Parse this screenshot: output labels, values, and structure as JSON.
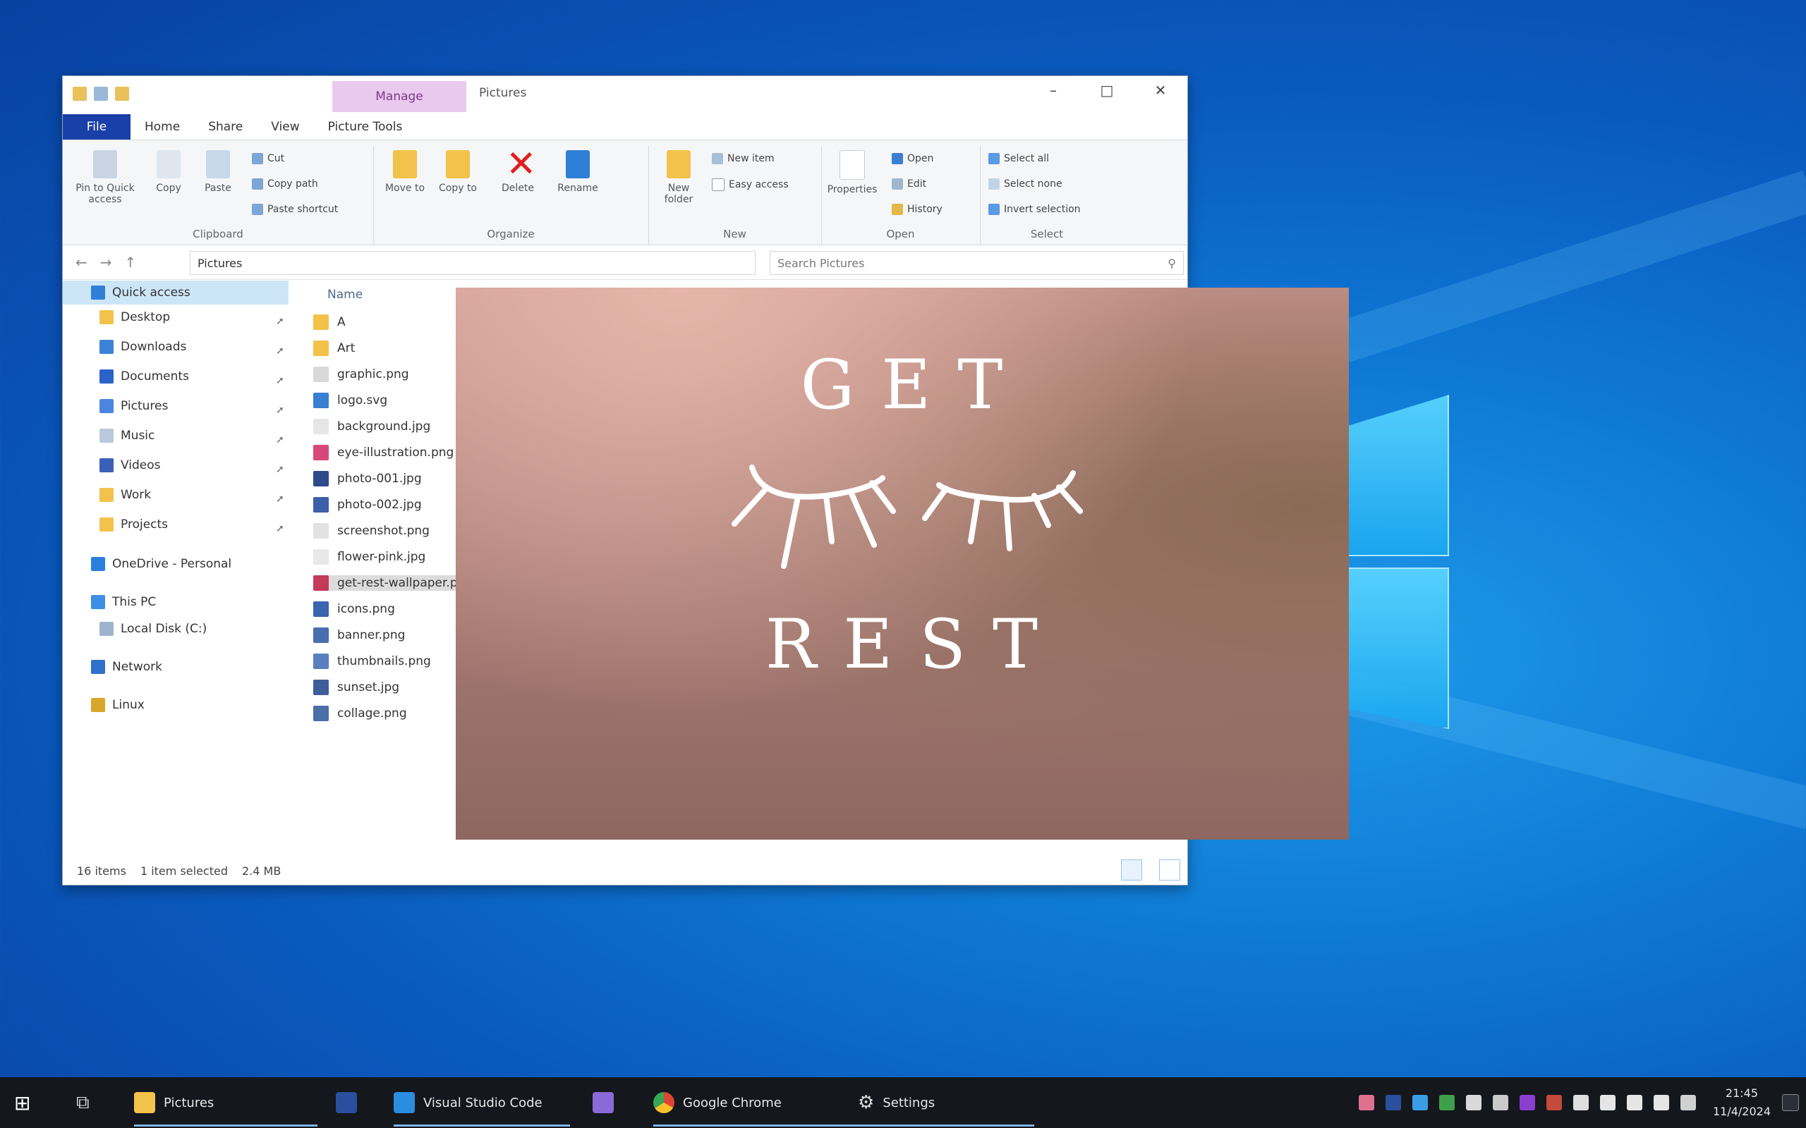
{
  "explorer": {
    "title": "Pictures",
    "context_tab": "Manage",
    "tabs": [
      "File",
      "Home",
      "Share",
      "View",
      "Picture Tools"
    ],
    "ribbon": {
      "clipboard": {
        "label": "Clipboard",
        "pin": "Pin to Quick access",
        "copy": "Copy",
        "paste": "Paste",
        "cut": "Cut",
        "copy_path": "Copy path",
        "paste_shortcut": "Paste shortcut"
      },
      "organize": {
        "label": "Organize",
        "move_to": "Move to",
        "copy_to": "Copy to",
        "delete": "Delete",
        "rename": "Rename"
      },
      "new": {
        "label": "New",
        "new_folder": "New folder",
        "new_item": "New item",
        "easy_access": "Easy access"
      },
      "open": {
        "label": "Open",
        "properties": "Properties",
        "open": "Open",
        "edit": "Edit",
        "history": "History"
      },
      "select": {
        "label": "Select",
        "select_all": "Select all",
        "select_none": "Select none",
        "invert": "Invert selection"
      }
    },
    "address": "Pictures",
    "search_placeholder": "Search Pictures",
    "nav": [
      {
        "label": "Quick access",
        "icon": "star-icon",
        "pinned": false
      },
      {
        "label": "Desktop",
        "icon": "folder-icon",
        "pinned": true
      },
      {
        "label": "Downloads",
        "icon": "download-icon",
        "pinned": true
      },
      {
        "label": "Documents",
        "icon": "document-icon",
        "pinned": true
      },
      {
        "label": "Pictures",
        "icon": "pictures-icon",
        "pinned": true
      },
      {
        "label": "Music",
        "icon": "music-icon",
        "pinned": true
      },
      {
        "label": "Videos",
        "icon": "video-icon",
        "pinned": true
      },
      {
        "label": "Work",
        "icon": "folder-icon",
        "pinned": true
      },
      {
        "label": "Projects",
        "icon": "folder-icon",
        "pinned": true
      },
      {
        "label": "OneDrive - Personal",
        "icon": "cloud-icon",
        "pinned": false
      },
      {
        "label": "This PC",
        "icon": "computer-icon",
        "pinned": false
      },
      {
        "label": "Local Disk (C:)",
        "icon": "drive-icon",
        "pinned": false
      },
      {
        "label": "Network",
        "icon": "network-icon",
        "pinned": false
      },
      {
        "label": "Linux",
        "icon": "linux-icon",
        "pinned": false
      }
    ],
    "files_header": "Name",
    "files": [
      {
        "name": "A",
        "icon": "folder-icon"
      },
      {
        "name": "Art",
        "icon": "folder-icon"
      },
      {
        "name": "graphic.png",
        "icon": "image-icon"
      },
      {
        "name": "logo.svg",
        "icon": "image-icon"
      },
      {
        "name": "background.jpg",
        "icon": "image-icon"
      },
      {
        "name": "eye-illustration.png",
        "icon": "image-icon"
      },
      {
        "name": "photo-001.jpg",
        "icon": "image-icon"
      },
      {
        "name": "photo-002.jpg",
        "icon": "image-icon"
      },
      {
        "name": "screenshot.png",
        "icon": "image-icon"
      },
      {
        "name": "flower-pink.jpg",
        "icon": "image-icon"
      },
      {
        "name": "get-rest-wallpaper.png",
        "icon": "image-icon"
      },
      {
        "name": "icons.png",
        "icon": "image-icon"
      },
      {
        "name": "banner.png",
        "icon": "image-icon"
      },
      {
        "name": "thumbnails.png",
        "icon": "image-icon"
      },
      {
        "name": "sunset.jpg",
        "icon": "image-icon"
      },
      {
        "name": "collage.png",
        "icon": "image-icon"
      }
    ],
    "status": {
      "count": "16 items",
      "selected": "1 item selected",
      "size": "2.4 MB"
    }
  },
  "preview": {
    "line1": "GET",
    "line2": "REST"
  },
  "taskbar": {
    "items": [
      {
        "label": "Pictures",
        "icon": "file-explorer-icon"
      },
      {
        "label": "Visual Studio Code",
        "icon": "vscode-icon"
      },
      {
        "label": "",
        "icon": "app-icon"
      },
      {
        "label": "Google Chrome",
        "icon": "chrome-icon"
      },
      {
        "label": "Settings",
        "icon": "settings-icon"
      }
    ],
    "time": "21:45",
    "date": "11/4/2024"
  },
  "colors": {
    "accent": "#1a3fa8",
    "context_tab": "#e9c9ee",
    "taskbar": "#14171c"
  }
}
